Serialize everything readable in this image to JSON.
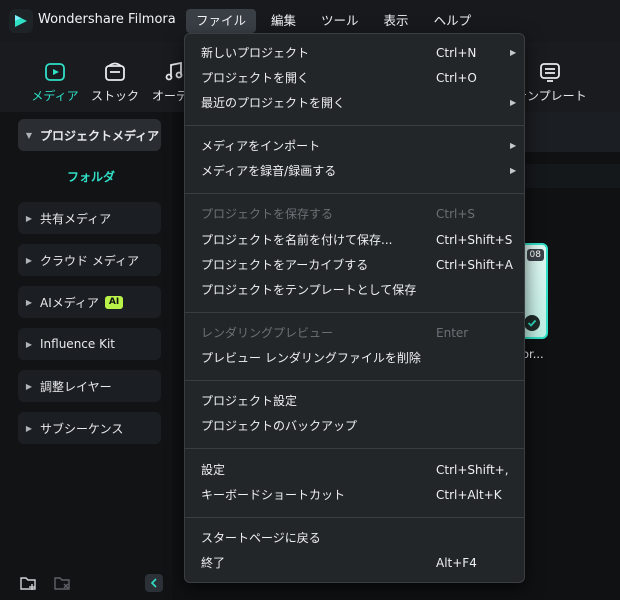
{
  "app": {
    "name": "Wondershare Filmora"
  },
  "menubar": [
    {
      "label": "ファイル",
      "active": true
    },
    {
      "label": "編集"
    },
    {
      "label": "ツール"
    },
    {
      "label": "表示"
    },
    {
      "label": "ヘルプ"
    }
  ],
  "toolbar": {
    "media": "メディア",
    "stock": "ストック",
    "audio": "オーディ",
    "template": "テンプレート"
  },
  "sidebar": {
    "project_media": "プロジェクトメディア",
    "folder": "フォルダ",
    "shared_media": "共有メディア",
    "cloud_media": "クラウド メディア",
    "ai_media": "AIメディア",
    "ai_badge": "AI",
    "influence_kit": "Influence Kit",
    "adjustment_layer": "調整レイヤー",
    "subsequence": "サブシーケンス"
  },
  "thumbnail": {
    "time": "08",
    "label": "or..."
  },
  "file_menu": {
    "new_project": {
      "label": "新しいプロジェクト",
      "shortcut": "Ctrl+N"
    },
    "open_project": {
      "label": "プロジェクトを開く",
      "shortcut": "Ctrl+O"
    },
    "recent_projects": {
      "label": "最近のプロジェクトを開く"
    },
    "import_media": {
      "label": "メディアをインポート"
    },
    "record_media": {
      "label": "メディアを録音/録画する"
    },
    "save_project": {
      "label": "プロジェクトを保存する",
      "shortcut": "Ctrl+S"
    },
    "save_as": {
      "label": "プロジェクトを名前を付けて保存...",
      "shortcut": "Ctrl+Shift+S"
    },
    "archive": {
      "label": "プロジェクトをアーカイブする",
      "shortcut": "Ctrl+Shift+A"
    },
    "save_template": {
      "label": "プロジェクトをテンプレートとして保存"
    },
    "render_preview": {
      "label": "レンダリングプレビュー",
      "shortcut": "Enter"
    },
    "delete_render": {
      "label": "プレビュー レンダリングファイルを削除"
    },
    "project_settings": {
      "label": "プロジェクト設定"
    },
    "backup": {
      "label": "プロジェクトのバックアップ"
    },
    "settings": {
      "label": "設定",
      "shortcut": "Ctrl+Shift+,"
    },
    "keyboard": {
      "label": "キーボードショートカット",
      "shortcut": "Ctrl+Alt+K"
    },
    "start_page": {
      "label": "スタートページに戻る"
    },
    "exit": {
      "label": "終了",
      "shortcut": "Alt+F4"
    }
  },
  "colors": {
    "accent": "#2fe0c6",
    "ai_badge": "#b9f34a"
  }
}
